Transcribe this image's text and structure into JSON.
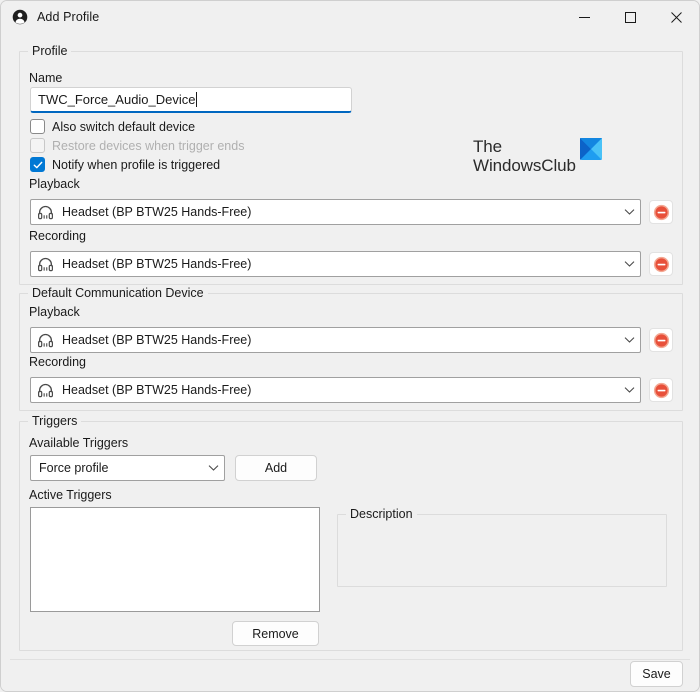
{
  "window": {
    "title": "Add Profile",
    "icon": "account-person-icon",
    "controls": {
      "minimize": "minimize-icon",
      "maximize": "maximize-icon",
      "close": "close-icon"
    }
  },
  "colors": {
    "background": "#f0f0f0",
    "accent": "#0078d4",
    "focus_underline": "#0067c0",
    "remove_icon": "#e8503a",
    "logo_mark": "#26a3e8"
  },
  "profile_group": {
    "title": "Profile",
    "name_label": "Name",
    "name_value": "TWC_Force_Audio_Device",
    "name_placeholder": "",
    "checkboxes": [
      {
        "label": "Also switch default device",
        "checked": false,
        "disabled": false
      },
      {
        "label": "Restore devices when trigger ends",
        "checked": false,
        "disabled": true
      },
      {
        "label": "Notify when profile is triggered",
        "checked": true,
        "disabled": false
      }
    ],
    "playback_label": "Playback",
    "playback_value": "Headset (BP BTW25 Hands-Free)",
    "recording_label": "Recording",
    "recording_value": "Headset (BP BTW25 Hands-Free)"
  },
  "default_comm_group": {
    "title": "Default Communication Device",
    "playback_label": "Playback",
    "playback_value": "Headset (BP BTW25 Hands-Free)",
    "recording_label": "Recording",
    "recording_value": "Headset (BP BTW25 Hands-Free)"
  },
  "triggers_group": {
    "title": "Triggers",
    "available_label": "Available Triggers",
    "available_value": "Force profile",
    "add_button": "Add",
    "active_label": "Active Triggers",
    "active_items": [],
    "remove_button": "Remove",
    "description_title": "Description",
    "description_text": ""
  },
  "footer": {
    "save_button": "Save"
  },
  "branding": {
    "line1": "The",
    "line2": "WindowsClub"
  }
}
